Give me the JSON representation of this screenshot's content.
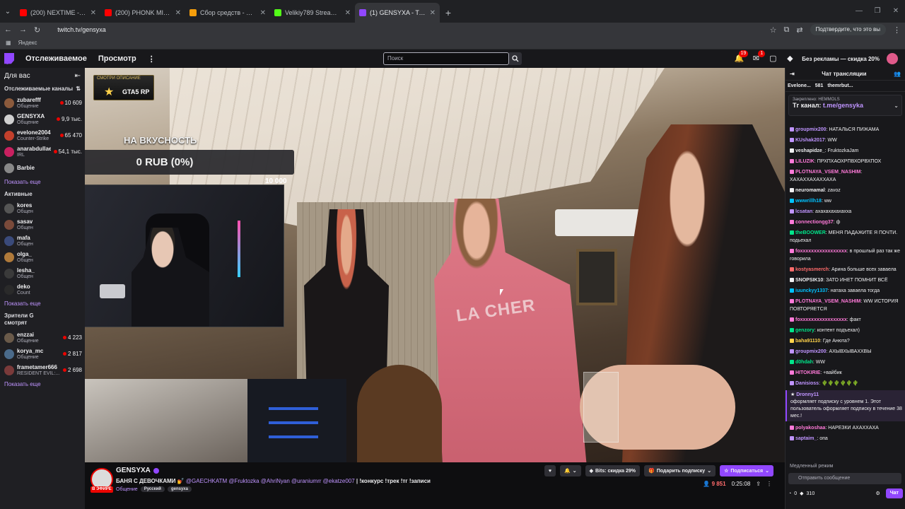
{
  "browser": {
    "tabs": [
      {
        "title": "(200) NEXTIME - СВЕТЛАНА (",
        "color": "#ff0000",
        "active": false
      },
      {
        "title": "(200) PHONK MIX 2025 ☠ NIG",
        "color": "#ff0000",
        "active": false
      },
      {
        "title": "Сбор средств - Виджеты - Do",
        "color": "#f59e0b",
        "active": false
      },
      {
        "title": "Velikiy789 Stream - Watch Live",
        "color": "#53fc18",
        "active": false
      },
      {
        "title": "(1) GENSYXA - Twitch",
        "color": "#9147ff",
        "active": true
      }
    ],
    "url": "twitch.tv/gensyxa",
    "confirm_label": "Подтвердите, что это вы",
    "bookmark": "Яндекс"
  },
  "nav": {
    "following": "Отслеживаемое",
    "browse": "Просмотр",
    "search_placeholder": "Поиск",
    "notif_count": "19",
    "inbox_count": "1",
    "turbo": "Без рекламы — скидка 20%"
  },
  "sidebar": {
    "title": "Для вас",
    "followed_header": "Отслеживаемые каналы",
    "followed": [
      {
        "name": "zubarefff",
        "cat": "Общение",
        "viewers": "10 609",
        "color": "#8b5a3c"
      },
      {
        "name": "GENSYXA",
        "cat": "Общение",
        "viewers": "9,9 тыс.",
        "color": "#d0d0d0"
      },
      {
        "name": "evelone2004",
        "cat": "Counter-Strike",
        "viewers": "65 470",
        "color": "#c2402c"
      },
      {
        "name": "anarabdullaev",
        "cat": "IRL",
        "viewers": "54,1 тыс.",
        "color": "#c92060"
      },
      {
        "name": "Barbie",
        "cat": "",
        "viewers": "",
        "color": "#888888"
      }
    ],
    "show_more_1": "Показать еще",
    "active_header": "Активные",
    "active": [
      {
        "name": "kores",
        "cat": "Общен",
        "color": "#555555"
      },
      {
        "name": "sasav",
        "cat": "Общен",
        "color": "#7a4a3a"
      },
      {
        "name": "mafa",
        "cat": "Общен",
        "color": "#3a4a7a"
      },
      {
        "name": "olga_",
        "cat": "Общен",
        "color": "#b07a3a"
      },
      {
        "name": "lesha_",
        "cat": "Общен",
        "color": "#3a3a3a"
      },
      {
        "name": "deko",
        "cat": "Count",
        "color": "#2a2a2a"
      }
    ],
    "show_more_2": "Показать еще",
    "viewers_header_1": "Зрители G",
    "viewers_header_2": "смотрят",
    "watching": [
      {
        "name": "enzzai",
        "cat": "Общение",
        "viewers": "4 223",
        "color": "#6a5a4a"
      },
      {
        "name": "korya_mc",
        "cat": "Общение",
        "viewers": "2 817",
        "color": "#4a6a8a"
      },
      {
        "name": "frametamer666",
        "cat": "RESIDENT EVIL:...",
        "viewers": "2 698",
        "color": "#7a3a3a"
      }
    ],
    "show_more_3": "Показать еще"
  },
  "overlay": {
    "gta_top": "СМОТРИ ОПИСАНИЕ",
    "gta_text": "GTA5 RP",
    "donation_title": "НА ВКУСНОСТЬ",
    "donation_amount": "0 RUB (0%)",
    "donation_min": "0",
    "donation_max": "10 000",
    "shirt_text": "LA CHER"
  },
  "stream": {
    "channel": "GENSYXA",
    "live_label": "В ЭФИРЕ",
    "title_text": "БАНЯ С ДЕВОЧКАМИ 💅",
    "mentions": "@GAECHKATM @Fruktozka @AhriNyan @uraniumrr @ekatze007",
    "title_end": "| !конкурс !трек !тг !записи",
    "category": "Общение",
    "tags": [
      "Русский",
      "gensyxa"
    ],
    "bits_label": "Bits: скидка 29%",
    "gift_label": "Подарить подписку",
    "subscribe_label": "Подписаться",
    "viewers": "9 851",
    "uptime": "0:25:08"
  },
  "chat": {
    "header": "Чат трансляции",
    "gift1": "Evelone...",
    "gift_count": "581",
    "gift2": "themrbut...",
    "pinned_label": "Закреплено: HEMMOLS",
    "pinned_msg_prefix": "Тг канал: ",
    "pinned_msg_link": "t.me/gensyka",
    "messages": [
      {
        "user": "groupmix200",
        "color": "#bf94ff",
        "text": ": НАТАЛЬСЯ ПИЖАМА"
      },
      {
        "user": "KUshak2017",
        "color": "#bf94ff",
        "text": ": WW"
      },
      {
        "user": "veshapidze_",
        "color": "#efeff1",
        "text": ": FruktozkaJam"
      },
      {
        "user": "LILUZIK",
        "color": "#ff7ad9",
        "text": ": ПРХПХАОХРПВХОРВХПОХ"
      },
      {
        "user": "PLOTNAYA_VSEM_NASHIM",
        "color": "#ff7ad9",
        "text": ": ХАХАХХАХАХХАХА"
      },
      {
        "user": "neuromamal",
        "color": "#efeff1",
        "text": ": zavoz"
      },
      {
        "user": "wwwrillh18",
        "color": "#00c2ff",
        "text": ": ww"
      },
      {
        "user": "lcsatan",
        "color": "#bf94ff",
        "text": ": ахахахахахахха"
      },
      {
        "user": "connectiongg37",
        "color": "#ff7ad9",
        "text": ": ф"
      },
      {
        "user": "theBOOWER",
        "color": "#00e68a",
        "text": ": МЕНЯ ПАДАЖИТЕ Я ПОЧТИ. подьехал"
      },
      {
        "user": "foxxxxxxxxxxxxxxxxx",
        "color": "#ff7ad9",
        "text": ": в прошлый раз так же говорила"
      },
      {
        "user": "kostyasmerch",
        "color": "#ff6b6b",
        "text": ": Арина больше всех заваела"
      },
      {
        "user": "SNOPSIK10",
        "color": "#efeff1",
        "text": ": ЗАТО ИНЕТ ПОМНИТ ВСЁ"
      },
      {
        "user": "iuunckyy1337",
        "color": "#00c2ff",
        "text": ": натаха заваела тогда"
      },
      {
        "user": "PLOTNAYA_VSEM_NASHIM",
        "color": "#ff7ad9",
        "text": ": WW ИСТОРИЯ ПОВТОРЯЕТСЯ"
      },
      {
        "user": "foxxxxxxxxxxxxxxxxx",
        "color": "#ff7ad9",
        "text": ": факт"
      },
      {
        "user": "genzory",
        "color": "#00e68a",
        "text": ": контент подъехал)"
      },
      {
        "user": "baha91110",
        "color": "#ffd24a",
        "text": ": Где Анюта?"
      },
      {
        "user": "groupmix200",
        "color": "#bf94ff",
        "text": ": АХЫВХЫВАХХВЫ"
      },
      {
        "user": "d0hdah",
        "color": "#00e68a",
        "text": ": WW"
      },
      {
        "user": "HITOKIRIE",
        "color": "#ff7ad9",
        "text": ": +вайбик"
      },
      {
        "user": "Danisioss",
        "color": "#bf94ff",
        "text": ": 🌵🌵🌵🌵🌵🌵"
      }
    ],
    "sub_user": "Dronny11",
    "sub_text": "оформляет подписку с уровнем 1. Этот пользователь оформляет подписку в течение 38 мес.!",
    "after": [
      {
        "user": "polyakoshaa",
        "color": "#ff7ad9",
        "text": ": НАРЕЗКИ АХАХХАХА"
      },
      {
        "user": "saptaim_",
        "color": "#bf94ff",
        "text": ": опа"
      }
    ],
    "slow_mode": "Медленный режим",
    "input_placeholder": "Отправить сообщение",
    "points": "0",
    "bits": "310",
    "chat_button": "Чат"
  }
}
